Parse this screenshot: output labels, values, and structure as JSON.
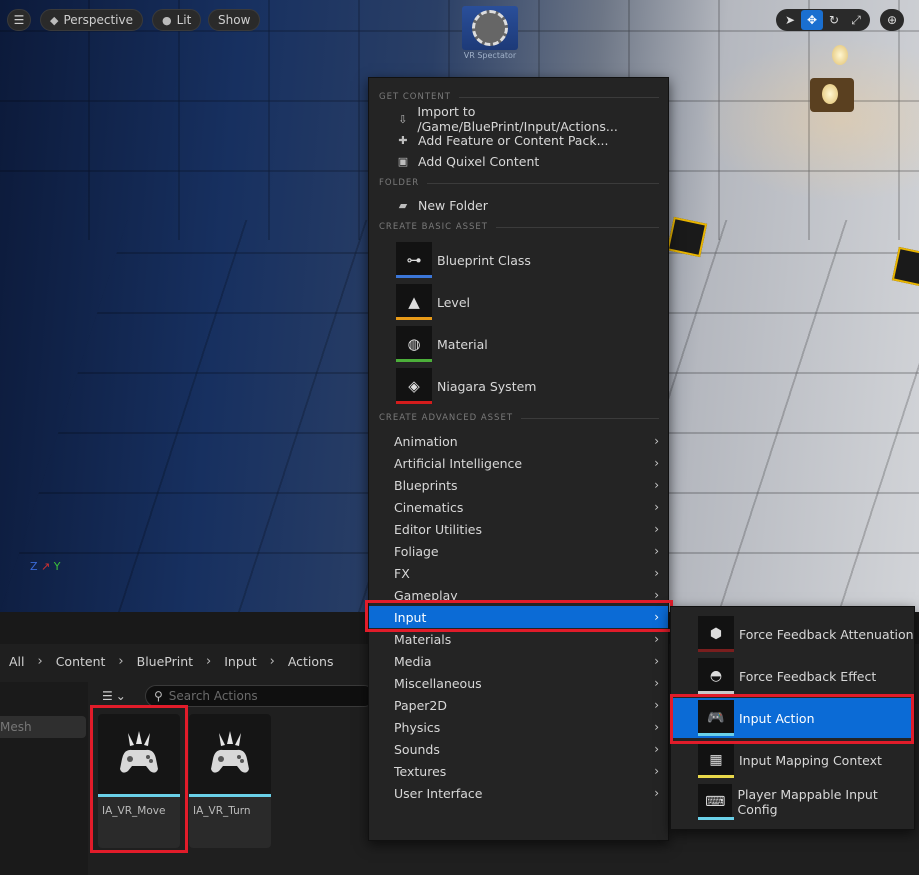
{
  "viewport": {
    "menu_icon": "hamburger-icon",
    "perspective_label": "Perspective",
    "lit_label": "Lit",
    "show_label": "Show",
    "spectator_label": "VR Spectator",
    "axis_x": "Z",
    "axis_y": "Y",
    "tools": [
      "select-icon",
      "move-icon",
      "rotate-icon",
      "scale-icon",
      "world-icon"
    ]
  },
  "context_menu": {
    "sections": {
      "get_content": "GET CONTENT",
      "folder": "FOLDER",
      "basic": "CREATE BASIC ASSET",
      "advanced": "CREATE ADVANCED ASSET"
    },
    "get_content_items": [
      {
        "label": "Import to /Game/BluePrint/Input/Actions...",
        "icon": "import-icon"
      },
      {
        "label": "Add Feature or Content Pack...",
        "icon": "feature-pack-icon"
      },
      {
        "label": "Add Quixel Content",
        "icon": "quixel-icon"
      }
    ],
    "folder_items": [
      {
        "label": "New Folder",
        "icon": "new-folder-icon"
      }
    ],
    "basic_assets": [
      {
        "label": "Blueprint Class",
        "icon": "blueprint-icon",
        "color": "#3b76d8"
      },
      {
        "label": "Level",
        "icon": "level-icon",
        "color": "#e89a18"
      },
      {
        "label": "Material",
        "icon": "material-icon",
        "color": "#4caf3a"
      },
      {
        "label": "Niagara System",
        "icon": "niagara-icon",
        "color": "#d41c1c"
      }
    ],
    "advanced_assets": [
      "Animation",
      "Artificial Intelligence",
      "Blueprints",
      "Cinematics",
      "Editor Utilities",
      "Foliage",
      "FX",
      "Gameplay",
      "Input",
      "Materials",
      "Media",
      "Miscellaneous",
      "Paper2D",
      "Physics",
      "Sounds",
      "Textures",
      "User Interface"
    ],
    "highlighted": "Input"
  },
  "input_submenu": {
    "items": [
      {
        "label": "Force Feedback Attenuation",
        "icon": "force-feedback-attenuation-icon",
        "color": "#7a1e1e"
      },
      {
        "label": "Force Feedback Effect",
        "icon": "force-feedback-effect-icon",
        "color": "#c9c9c9"
      },
      {
        "label": "Input Action",
        "icon": "gamepad-icon",
        "color": "#6ad0e8"
      },
      {
        "label": "Input Mapping Context",
        "icon": "mapping-context-icon",
        "color": "#e8d84a"
      },
      {
        "label": "Player Mappable Input Config",
        "icon": "keyboard-icon",
        "color": "#6ad0e8"
      }
    ],
    "highlighted": "Input Action"
  },
  "content_browser": {
    "breadcrumb": [
      "All",
      "Content",
      "BluePrint",
      "Input",
      "Actions"
    ],
    "search_placeholder": "Search Actions",
    "left_filter_text": "Mesh",
    "assets": [
      {
        "name": "IA_VR_Move",
        "icon": "gamepad-icon"
      },
      {
        "name": "IA_VR_Turn",
        "icon": "gamepad-icon"
      }
    ]
  }
}
